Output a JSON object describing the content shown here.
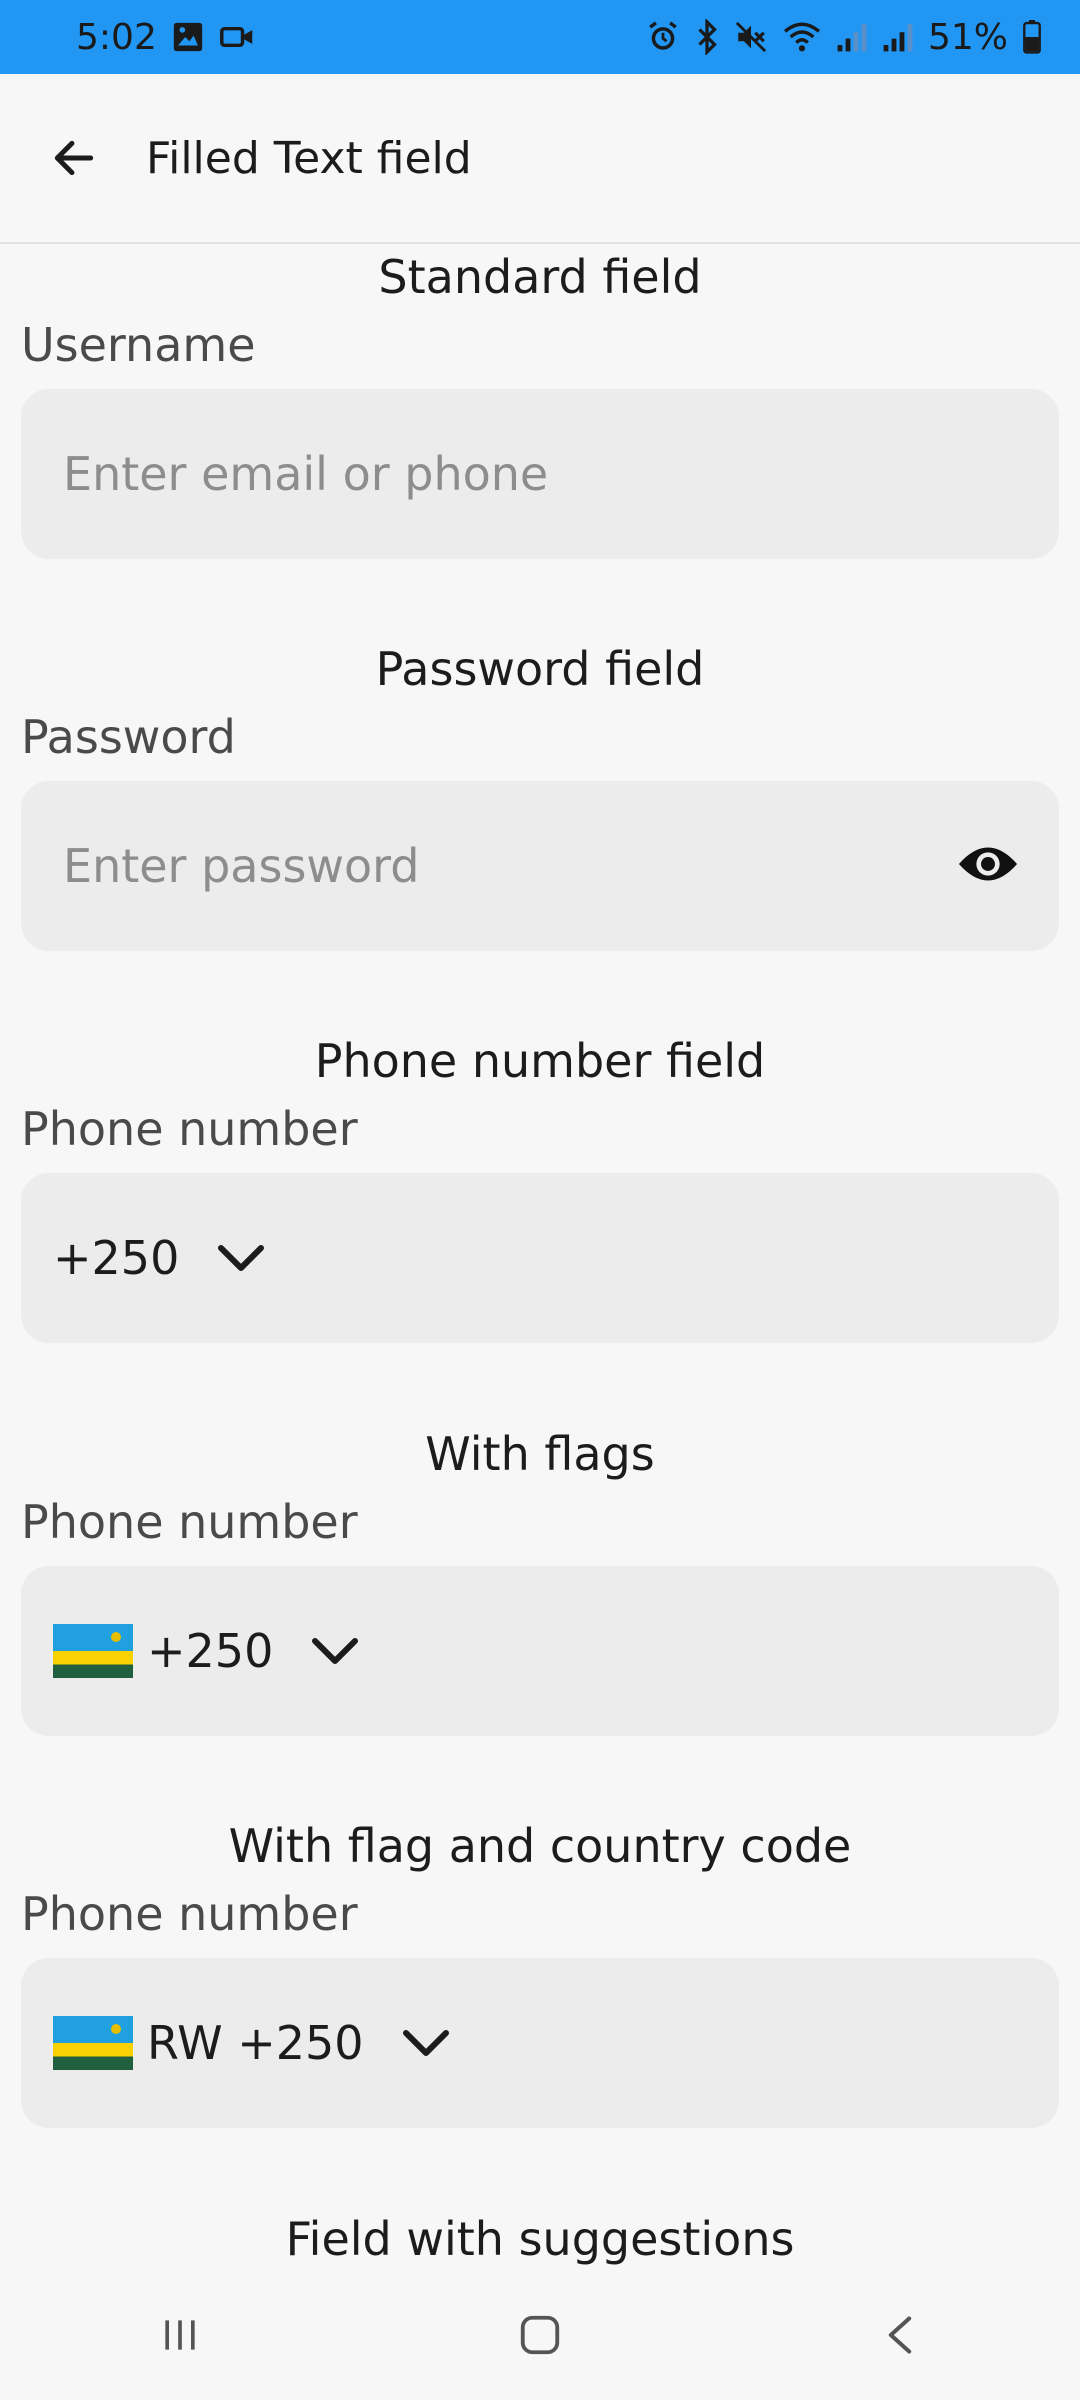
{
  "status_bar": {
    "time": "5:02",
    "battery": "51%",
    "left_icons": [
      "gallery-icon",
      "video-icon"
    ],
    "right_icons": [
      "alarm-icon",
      "bluetooth-icon",
      "mute-icon",
      "wifi-icon",
      "signal-icon",
      "signal-icon",
      "battery-icon"
    ]
  },
  "app_bar": {
    "title": "Filled Text field",
    "back_icon": "arrow-left-icon"
  },
  "sections": {
    "standard": {
      "title": "Standard field",
      "label": "Username",
      "placeholder": "Enter email or phone"
    },
    "password": {
      "title": "Password field",
      "label": "Password",
      "placeholder": "Enter password",
      "toggle_icon": "eye-icon"
    },
    "phone": {
      "title": "Phone number field",
      "label": "Phone number",
      "code": "+250"
    },
    "flags": {
      "title": "With flags",
      "label": "Phone number",
      "code": "+250",
      "flag": "rwanda-flag-icon"
    },
    "flag_country": {
      "title": "With flag and country code",
      "label": "Phone number",
      "code": "RW +250",
      "flag": "rwanda-flag-icon"
    },
    "suggestions": {
      "title": "Field with suggestions"
    }
  },
  "colors": {
    "status_bar": "#2196f3",
    "background": "#f7f7f7",
    "field_fill": "#ececec",
    "flag_blue": "#20a0de",
    "flag_yellow": "#fad201",
    "flag_green": "#20603d"
  }
}
